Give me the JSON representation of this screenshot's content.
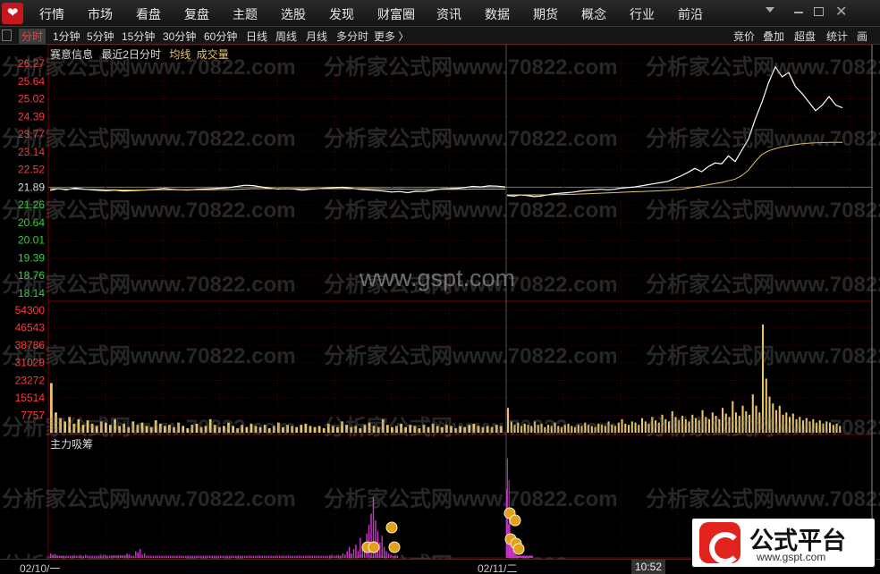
{
  "menu": {
    "items": [
      "行情",
      "市场",
      "看盘",
      "复盘",
      "主题",
      "选股",
      "发现",
      "财富圈",
      "资讯",
      "数据",
      "期货",
      "概念",
      "行业",
      "前沿"
    ]
  },
  "periods": {
    "items": [
      "分时",
      "1分钟",
      "5分钟",
      "15分钟",
      "30分钟",
      "60分钟",
      "日线",
      "周线",
      "月线",
      "多分时",
      "更多 〉"
    ],
    "active": "分时"
  },
  "right_tabs": [
    "竞价",
    "叠加",
    "超盘",
    "统计",
    "画"
  ],
  "info": {
    "title": "赛意信息",
    "range": "最近2日分时",
    "avg_legend": "均线",
    "vol_legend": "成交量",
    "avg_color": "#e8c46a",
    "vol_color": "#e8c46a"
  },
  "indicator": {
    "label": "主力吸筹",
    "color": "#cc33cc"
  },
  "watermarks": {
    "site": "分析家公式网www.70822.com",
    "center": "www.gspt.com"
  },
  "footer": {
    "date1": "02/10/一",
    "date2": "02/11/二",
    "time": "10:52"
  },
  "brand": {
    "title": "公式平台",
    "url": "www.gspt.com"
  },
  "colors": {
    "up": "#ff3b3b",
    "down": "#3bd13b",
    "price_line": "#ffffff",
    "grid": "#4a0000",
    "bg": "#000000"
  },
  "chart_data": {
    "type": "line",
    "price_axis": {
      "ticks": [
        "26.27",
        "25.64",
        "25.02",
        "24.39",
        "23.77",
        "23.14",
        "22.52",
        "21.89",
        "21.26",
        "20.64",
        "20.01",
        "19.39",
        "18.76",
        "18.14"
      ],
      "ref": 21.89,
      "ylim": [
        18.14,
        26.27
      ]
    },
    "volume_axis": {
      "ticks": [
        "54300",
        "46543",
        "38786",
        "31029",
        "23272",
        "15514",
        "7757"
      ],
      "ylim": [
        0,
        54300
      ]
    },
    "x_labels": [
      "02/10/一",
      "02/11/二"
    ],
    "series": [
      {
        "name": "分时",
        "values": [
          21.78,
          21.84,
          21.8,
          21.86,
          21.83,
          21.8,
          21.78,
          21.77,
          21.79,
          21.76,
          21.77,
          21.78,
          21.8,
          21.82,
          21.85,
          21.82,
          21.8,
          21.79,
          21.82,
          21.83,
          21.84,
          21.86,
          21.88,
          21.92,
          21.96,
          21.95,
          21.9,
          21.86,
          21.83,
          21.84,
          21.83,
          21.79,
          21.82,
          21.84,
          21.86,
          21.88,
          21.89,
          21.86,
          21.82,
          21.8,
          21.78,
          21.76,
          21.72,
          21.74,
          21.7,
          21.75,
          21.74,
          21.78,
          21.83,
          21.84,
          21.85,
          21.88,
          21.92,
          21.9,
          21.94,
          21.93,
          21.9,
          21.6,
          21.58,
          21.62,
          21.6,
          21.56,
          21.58,
          21.62,
          21.66,
          21.68,
          21.7,
          21.72,
          21.76,
          21.78,
          21.8,
          21.82,
          21.8,
          21.82,
          21.86,
          21.88,
          21.9,
          21.94,
          21.98,
          22.02,
          22.06,
          22.1,
          22.2,
          22.3,
          22.42,
          22.56,
          22.44,
          22.62,
          22.75,
          22.72,
          23.0,
          22.8,
          23.2,
          23.6,
          24.3,
          24.9,
          25.6,
          26.15,
          25.8,
          25.95,
          25.45,
          25.2,
          24.9,
          24.6,
          24.8,
          25.1,
          24.8,
          24.7
        ],
        "color": "#ffffff"
      },
      {
        "name": "均线",
        "values": [
          21.84,
          21.84,
          21.83,
          21.83,
          21.82,
          21.82,
          21.81,
          21.8,
          21.8,
          21.79,
          21.79,
          21.79,
          21.79,
          21.8,
          21.8,
          21.8,
          21.8,
          21.8,
          21.8,
          21.8,
          21.8,
          21.81,
          21.81,
          21.82,
          21.83,
          21.84,
          21.84,
          21.84,
          21.84,
          21.84,
          21.84,
          21.84,
          21.84,
          21.84,
          21.84,
          21.84,
          21.84,
          21.84,
          21.84,
          21.84,
          21.84,
          21.83,
          21.83,
          21.83,
          21.82,
          21.82,
          21.82,
          21.82,
          21.82,
          21.82,
          21.82,
          21.82,
          21.83,
          21.83,
          21.83,
          21.83,
          21.83,
          21.62,
          21.62,
          21.62,
          21.62,
          21.62,
          21.62,
          21.62,
          21.63,
          21.63,
          21.64,
          21.64,
          21.65,
          21.66,
          21.67,
          21.68,
          21.69,
          21.7,
          21.71,
          21.72,
          21.73,
          21.74,
          21.75,
          21.76,
          21.77,
          21.78,
          21.8,
          21.82,
          21.86,
          21.9,
          21.94,
          21.98,
          22.02,
          22.06,
          22.12,
          22.18,
          22.3,
          22.5,
          22.8,
          23.05,
          23.18,
          23.26,
          23.32,
          23.36,
          23.4,
          23.43,
          23.45,
          23.46,
          23.47,
          23.48,
          23.48,
          23.48
        ],
        "color": "#e8c46a"
      }
    ],
    "volume": [
      {
        "day": 1,
        "values": [
          22000,
          9000,
          6500,
          5000,
          7000,
          4000,
          6000,
          3500,
          5500,
          4000,
          3000,
          5000,
          4500,
          3500,
          6000,
          3000,
          4000,
          2500,
          5000,
          3500,
          4500,
          3000,
          2500,
          5500,
          4000,
          3000,
          3500,
          2500,
          4500,
          3000,
          2000,
          3500,
          4000,
          2500,
          3000,
          6000,
          3500,
          2500,
          3000,
          4500,
          3000,
          2000,
          3500,
          2500,
          4000,
          3000,
          2500,
          3500,
          2000,
          3000,
          4500,
          2500,
          3500,
          3000,
          2500,
          3500,
          4000,
          3000,
          2500,
          3000,
          2000,
          4000,
          3000,
          2500,
          5000,
          3500,
          2500,
          3000,
          2000,
          3500,
          4500,
          3000,
          2500,
          6000,
          3500,
          2500,
          3000,
          4000,
          2500,
          3500,
          3000,
          2000,
          3500,
          2500,
          4000,
          3000,
          2500,
          3500,
          3000,
          2000,
          3000,
          2500,
          3500,
          4000,
          3000,
          2500,
          3000,
          2500,
          3500,
          3000
        ]
      },
      {
        "day": 2,
        "values": [
          11000,
          5000,
          3500,
          4500,
          3000,
          4000,
          3500,
          3000,
          5000,
          3500,
          4000,
          2500,
          3500,
          3000,
          4500,
          3000,
          2500,
          3500,
          4000,
          3000,
          2500,
          3500,
          3000,
          4500,
          3500,
          3000,
          2500,
          4000,
          3500,
          3000,
          5000,
          3500,
          3000,
          4500,
          6000,
          4000,
          3500,
          5000,
          4500,
          3500,
          6500,
          5000,
          4000,
          7000,
          5500,
          4500,
          8000,
          6000,
          5000,
          9500,
          7000,
          5500,
          7500,
          6000,
          5000,
          8000,
          6500,
          5500,
          10000,
          7000,
          6000,
          9000,
          7500,
          6000,
          11000,
          8500,
          7000,
          14000,
          9000,
          7500,
          12000,
          9500,
          8000,
          17000,
          12000,
          9000,
          48000,
          24000,
          16000,
          13000,
          10000,
          12000,
          8000,
          9000,
          7000,
          8500,
          6000,
          7000,
          5500,
          6500,
          5000,
          6000,
          4500,
          5500,
          4000,
          5000,
          4500,
          3500,
          4000,
          3000
        ]
      }
    ],
    "indicator_bars": {
      "ylim": [
        0,
        100
      ],
      "day1": [
        4,
        3,
        3,
        2,
        2,
        2,
        2,
        2,
        2,
        2,
        2,
        2,
        2,
        2,
        2,
        2,
        3,
        2,
        2,
        2,
        2,
        2,
        2,
        2,
        2,
        2,
        2,
        2,
        2,
        2,
        2,
        2,
        2,
        2,
        2,
        4,
        3,
        2,
        2,
        6,
        5,
        8,
        3,
        4,
        2,
        2,
        2,
        2,
        2,
        2,
        2,
        2,
        2,
        2,
        2,
        2,
        2,
        2,
        2,
        2,
        2,
        2,
        2,
        2,
        2,
        2,
        2,
        2,
        2,
        2,
        2,
        2,
        2,
        2,
        2,
        2,
        2,
        2,
        2,
        2,
        2,
        2,
        2,
        2,
        2,
        2,
        2,
        2,
        2,
        2,
        2,
        2,
        2,
        2,
        2,
        2,
        2,
        2,
        2,
        2,
        2,
        2,
        2,
        2,
        2,
        2,
        2,
        2,
        2,
        2,
        2,
        2,
        2,
        2,
        2,
        2,
        2,
        2,
        2,
        2,
        2,
        2,
        2,
        2,
        2,
        2,
        2,
        2,
        2,
        2,
        2,
        2,
        2,
        2,
        4,
        3,
        6,
        10,
        4,
        8,
        12,
        6,
        18,
        10,
        14,
        22,
        30,
        40,
        55,
        34,
        24,
        14,
        20,
        10,
        6,
        4,
        3,
        2,
        2,
        2
      ],
      "day2": [
        62,
        90,
        30,
        70,
        36,
        22,
        14,
        10,
        8,
        6,
        4,
        3,
        3,
        2,
        2,
        2,
        2,
        2,
        2,
        2,
        2,
        2,
        2,
        2,
        2,
        2,
        2,
        2,
        2,
        2,
        2,
        2,
        2,
        2
      ]
    },
    "xlabel": "",
    "ylabel": "",
    "grid": true
  }
}
